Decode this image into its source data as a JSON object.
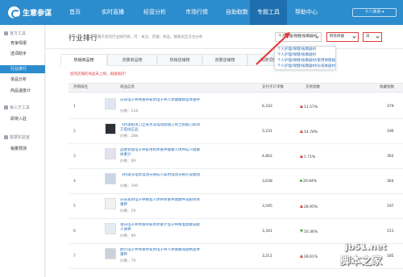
{
  "app": {
    "logo_text": "生意参谋",
    "accent": "#2d8ccd",
    "user_label": "十八未央 ▾"
  },
  "nav": [
    {
      "label": "首页"
    },
    {
      "label": "实时直播"
    },
    {
      "label": "经营分析"
    },
    {
      "label": "市场行情"
    },
    {
      "label": "自助取数"
    },
    {
      "label": "专题工具"
    },
    {
      "label": "帮助中心"
    }
  ],
  "sidebar": {
    "sections": [
      {
        "label": "官方工具",
        "items": [
          "竞争情报",
          "选词助手",
          "行业排行",
          "单品分析",
          "商品温度计"
        ]
      },
      {
        "label": "第三方工具",
        "items": [
          "即将入驻"
        ]
      },
      {
        "label": "数据实验室",
        "items": [
          "销量预测"
        ]
      }
    ]
  },
  "page": {
    "title": "行业排行",
    "breadcrumb": "属于您的行业排行榜，可 - 关注，店铺，商品，搜索词全方位分析",
    "category_select": "个人护理/保健/按摩器材",
    "terminal_select": "所有终端",
    "period_select": "日",
    "hint": "您的店铺的商品未上榜，再接再厉！"
  },
  "dropdown": [
    "个人护理/保健/按摩器材",
    "个人护理/保健/按摩器材",
    "个人护理/保健/按摩器材/家用保健器材",
    "个人护理/保健/按摩器材/仪表肤器材"
  ],
  "tabs": [
    "热销商品榜",
    "流量商品榜",
    "热销店铺榜",
    "流量店铺榜",
    "热搜词榜"
  ],
  "table": {
    "headers": [
      "热销排名",
      "商品信息",
      "支付子订单数",
      "交易指数",
      "收藏指数"
    ],
    "rows": [
      {
        "rank": "1",
        "name": "乐肯电子秤体重秤家用电子秤人体健康精准体重秤",
        "price": "价格：118",
        "paid": "6,333",
        "conversion": "11.57%",
        "trend": "up",
        "collect": "379"
      },
      {
        "rank": "2",
        "name": "飞利浦剃须刀全身水洗电动刮胡刀男士刮胡刀剃须刀电动正品",
        "price": "价格：288",
        "paid": "5,231",
        "conversion": "14.78%",
        "trend": "up",
        "collect": "196"
      },
      {
        "rank": "3",
        "name": "品胜智能电子秤家用称体重秤健康人体秤成人健康体重计",
        "price": "价格：69",
        "paid": "4,802",
        "conversion": "1.71%",
        "trend": "up",
        "collect": "362"
      },
      {
        "rank": "4",
        "name": "飞利浦充电式电动牙刷成人家用电动牙刷声波震动",
        "price": "价格：199",
        "paid": "3,638",
        "conversion": "20.94%",
        "trend": "dot",
        "collect": "364"
      },
      {
        "rank": "5",
        "name": "乐肯家用电子秤精准人体秤体重秤健康秤减肥称体重秤",
        "price": "价格：29",
        "paid": "3,595",
        "conversion": "28.95%",
        "trend": "up",
        "collect": "197"
      },
      {
        "rank": "6",
        "name": "香山电子秤体重秤家用体重计电子秤精准健康减肥人体秤",
        "price": "价格：99",
        "paid": "3,341",
        "conversion": "10.36%",
        "trend": "down",
        "collect": "151"
      },
      {
        "rank": "7",
        "name": "欧贝电子秤体重秤家用电子秤人体健康减肥精准体重秤",
        "price": "价格：79",
        "paid": "3,211",
        "conversion": "28.61%",
        "trend": "up",
        "collect": "185"
      }
    ]
  },
  "watermark": {
    "site": "jb51.net",
    "brand": "脚本之家",
    "sub": "脚本之家"
  }
}
